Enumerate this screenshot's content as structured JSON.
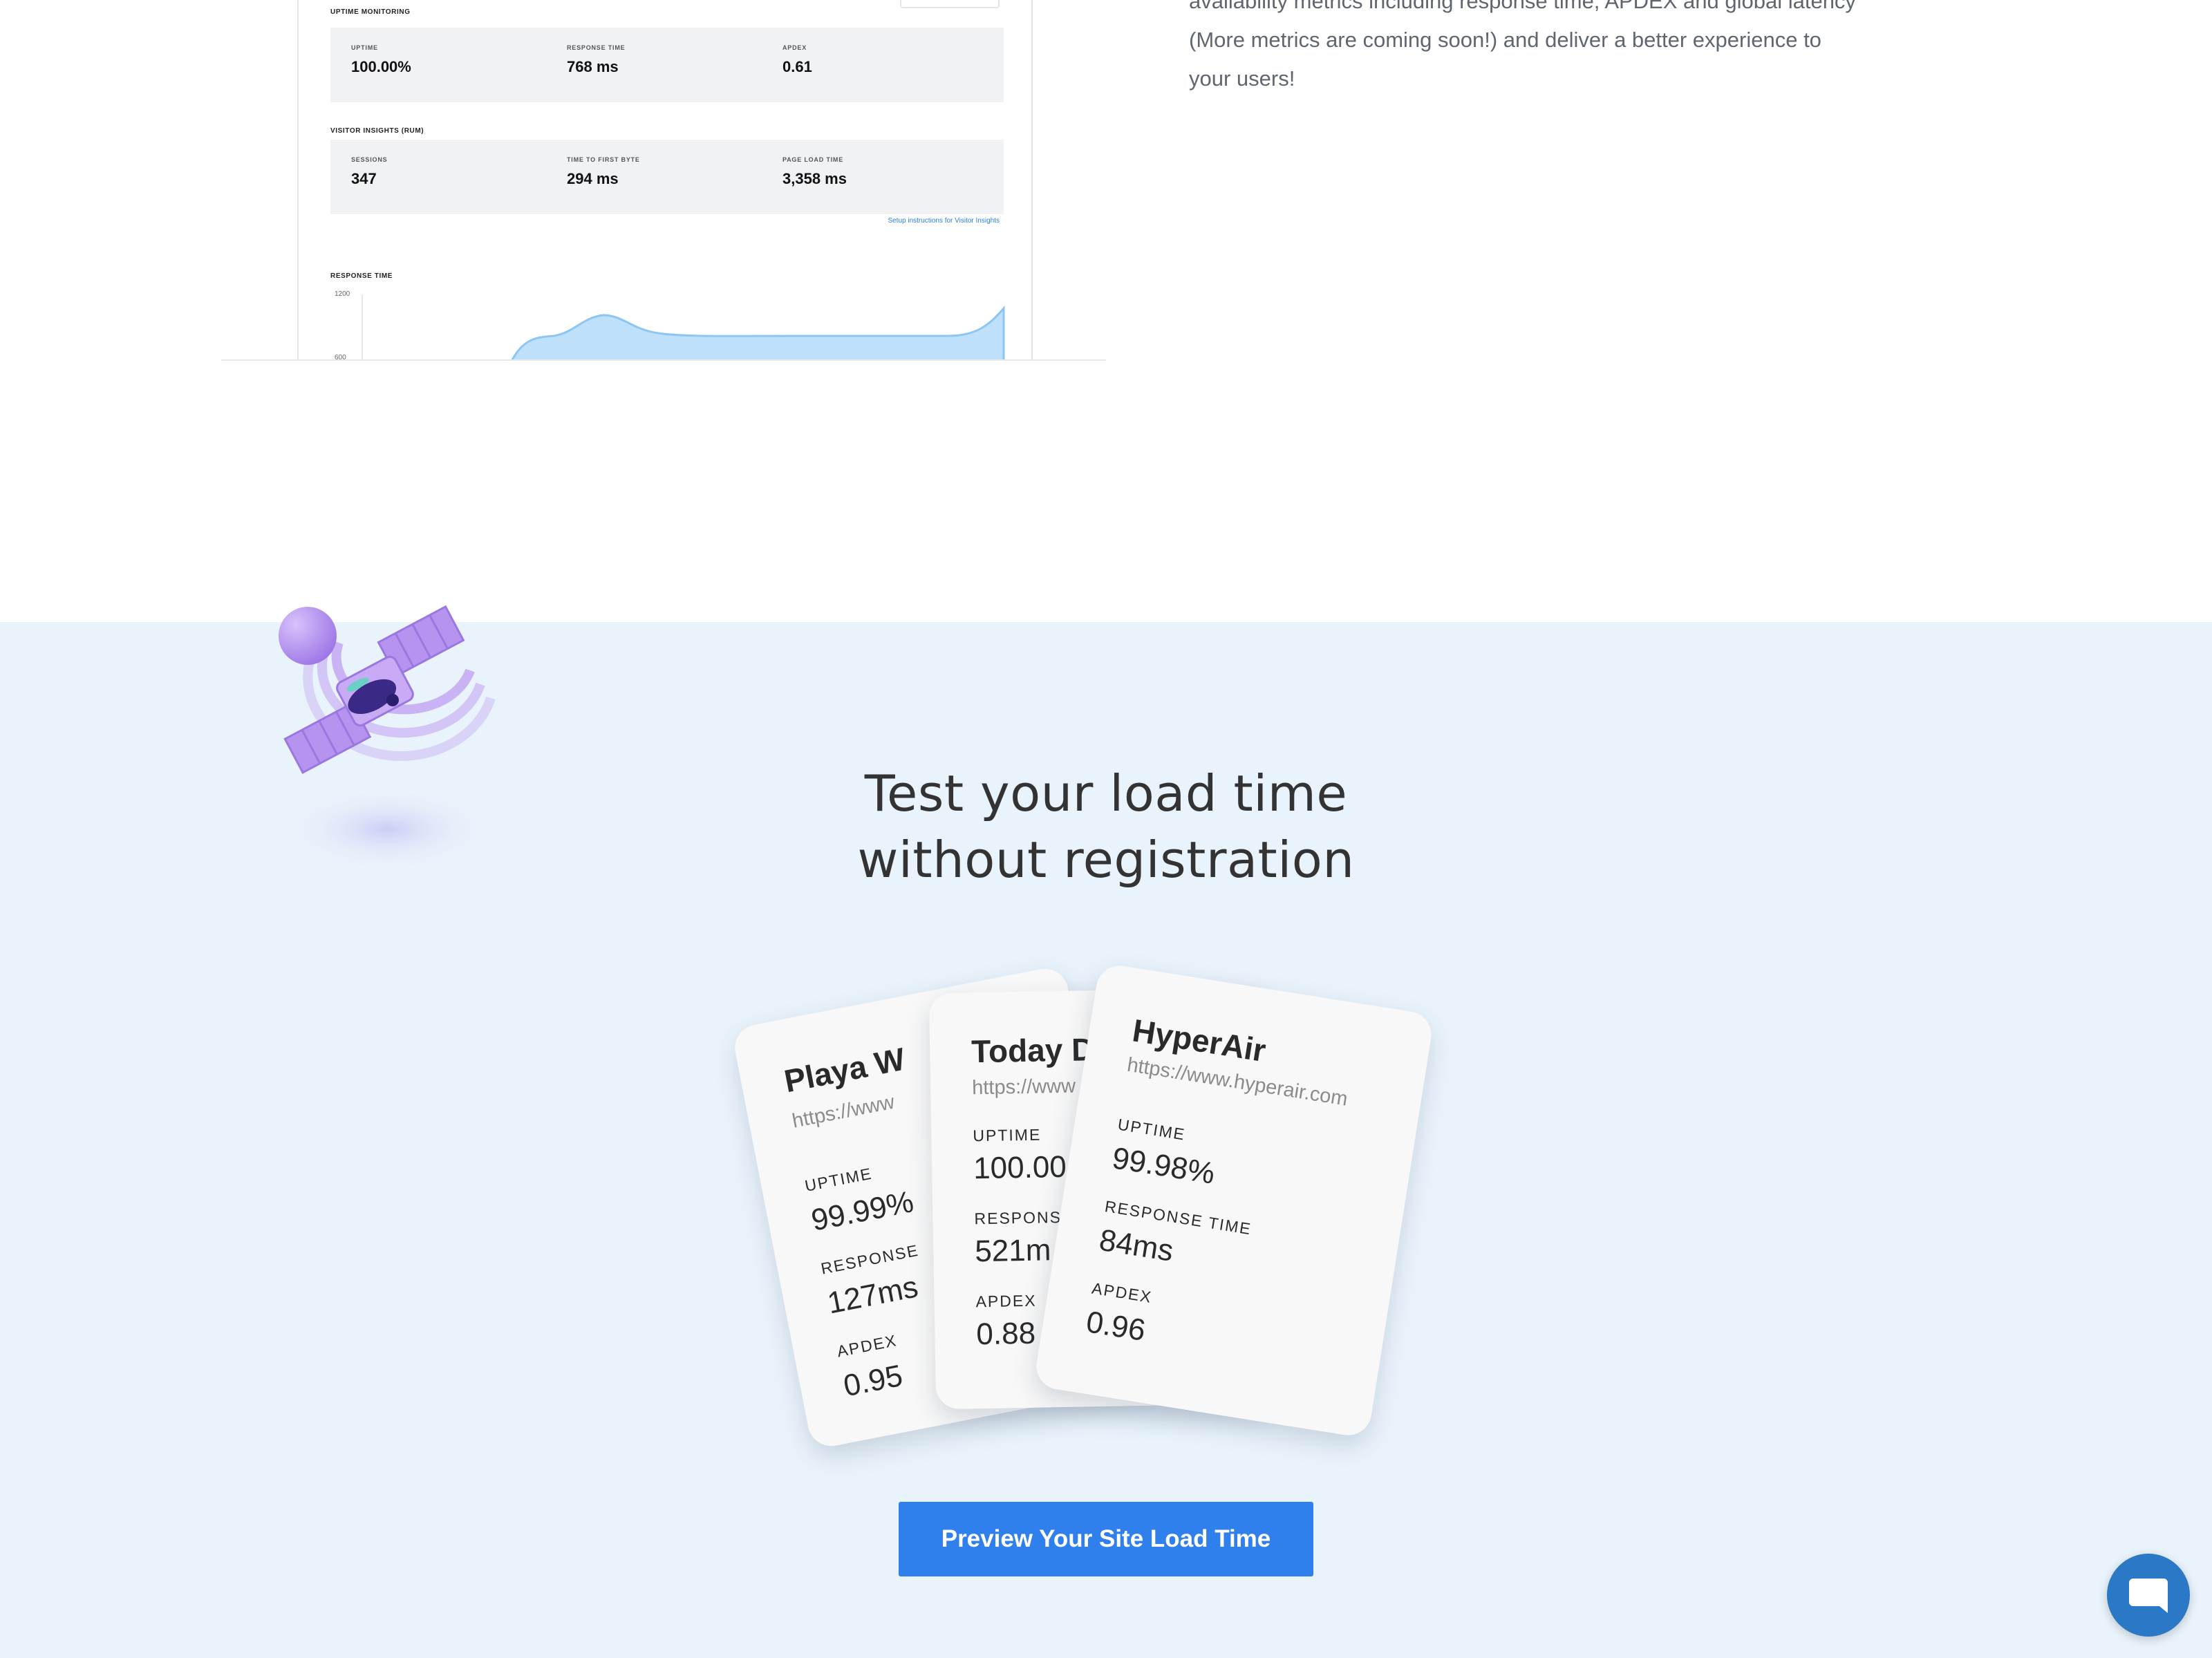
{
  "dashboard": {
    "uptime_section_label": "UPTIME MONITORING",
    "uptime_metrics": [
      {
        "label": "UPTIME",
        "value": "100.00%"
      },
      {
        "label": "RESPONSE TIME",
        "value": "768 ms"
      },
      {
        "label": "APDEX",
        "value": "0.61"
      }
    ],
    "rum_section_label": "VISITOR INSIGHTS (RUM)",
    "rum_metrics": [
      {
        "label": "SESSIONS",
        "value": "347"
      },
      {
        "label": "TIME TO FIRST BYTE",
        "value": "294 ms"
      },
      {
        "label": "PAGE LOAD TIME",
        "value": "3,358 ms"
      }
    ],
    "setup_link": "Setup instructions for Visitor Insights",
    "chart_label": "RESPONSE TIME",
    "chart_y_ticks": [
      "1200",
      "600"
    ]
  },
  "intro": {
    "lines": [
      "availability metrics including response time, APDEX and global latency",
      "(More metrics are coming soon!) and deliver a better experience to",
      "your users!"
    ]
  },
  "hero": {
    "headline_line1": "Test your load time",
    "headline_line2": "without registration"
  },
  "cards": [
    {
      "name": "Playa W",
      "url": "https://www",
      "uptime_label": "UPTIME",
      "uptime": "99.99%",
      "response_label": "RESPONSE",
      "response": "127ms",
      "apdex_label": "APDEX",
      "apdex": "0.95"
    },
    {
      "name": "Today D",
      "url": "https://www",
      "uptime_label": "UPTIME",
      "uptime": "100.00",
      "response_label": "RESPONSE",
      "response": "521m",
      "apdex_label": "APDEX",
      "apdex": "0.88"
    },
    {
      "name": "HyperAir",
      "url": "https://www.hyperair.com",
      "uptime_label": "UPTIME",
      "uptime": "99.98%",
      "response_label": "RESPONSE TIME",
      "response": "84ms",
      "apdex_label": "APDEX",
      "apdex": "0.96"
    }
  ],
  "cta": {
    "label": "Preview Your Site Load Time"
  },
  "colors": {
    "accent": "#2f80ed",
    "section_bg": "#e9f3fb",
    "chat_button": "#2b78c6",
    "chart_fill": "#bfe0fb",
    "chart_line": "#8cc6f4",
    "satellite_purple": "#b693ee"
  },
  "icons": {
    "chat": "chat-bubble-icon",
    "satellite": "satellite-illustration"
  }
}
